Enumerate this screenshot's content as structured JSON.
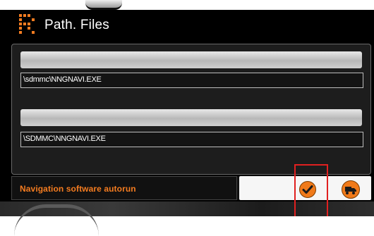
{
  "window": {
    "title": "Path. Files",
    "logo_icon": "dotted-logo-icon"
  },
  "paths": [
    {
      "value": "\\sdmmc\\NNGNAVI.EXE"
    },
    {
      "value": "\\SDMMC\\NNGNAVI.EXE"
    }
  ],
  "autorun": {
    "label": "Navigation software autorun",
    "confirm_icon": "checkmark-icon",
    "secondary_icon": "truck-icon"
  },
  "colors": {
    "accent": "#f47c20",
    "highlight": "#e02020",
    "background": "#000000"
  }
}
